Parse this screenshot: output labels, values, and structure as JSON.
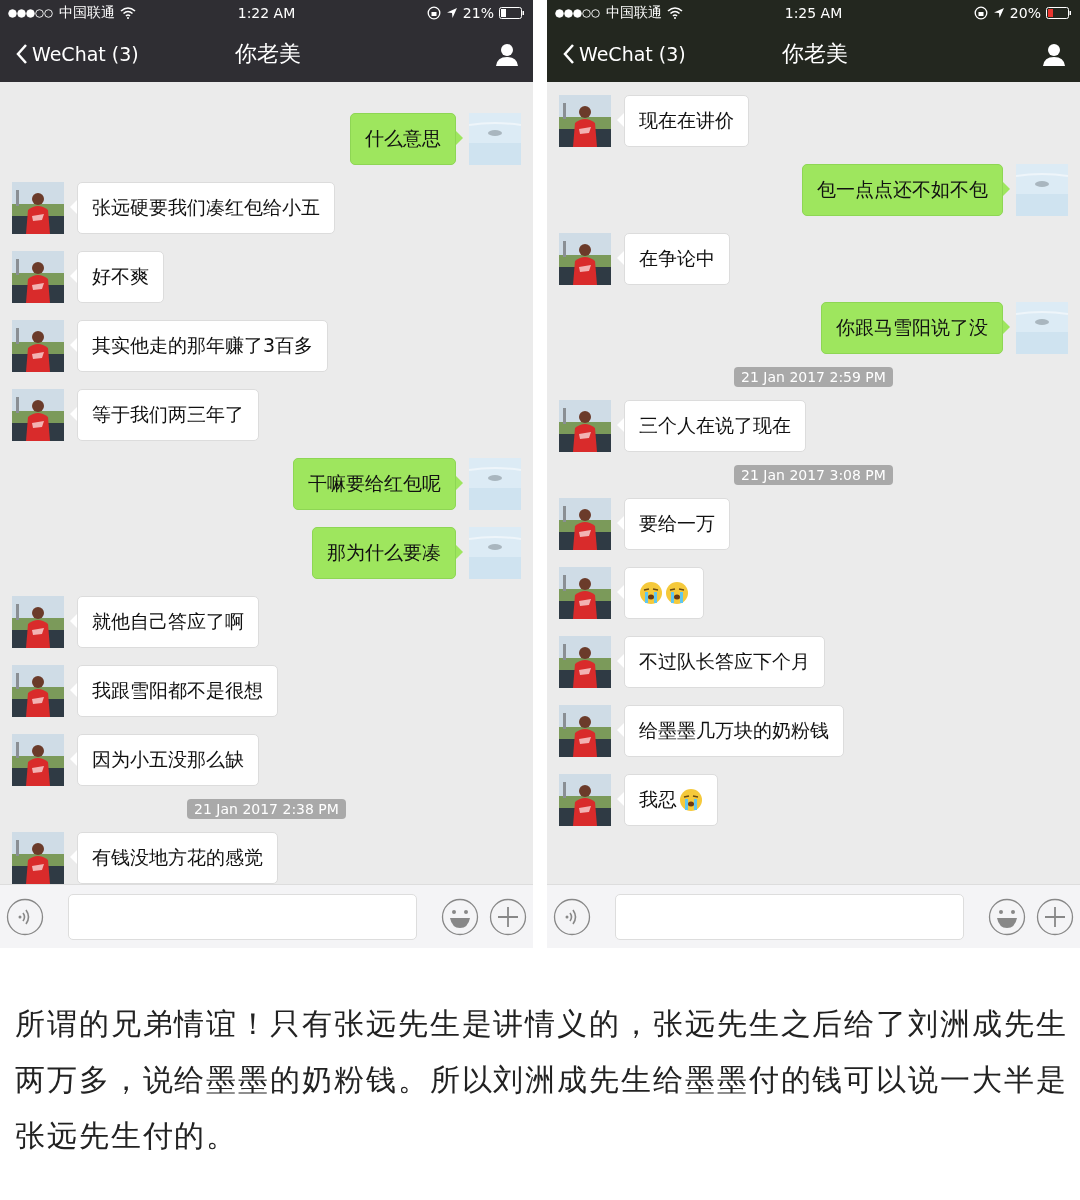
{
  "phones": [
    {
      "status_bar": {
        "carrier": "中国联通",
        "time": "1:22 AM",
        "battery": "21%",
        "low_battery": false
      },
      "nav": {
        "back": "WeChat (3)",
        "title": "你老美"
      },
      "messages": [
        {
          "kind": "message",
          "outgoing": true,
          "parts": [
            {
              "kind": "text",
              "text": "什么意思"
            }
          ]
        },
        {
          "kind": "message",
          "outgoing": false,
          "parts": [
            {
              "kind": "text",
              "text": "张远硬要我们凑红包给小五"
            }
          ]
        },
        {
          "kind": "message",
          "outgoing": false,
          "parts": [
            {
              "kind": "text",
              "text": "好不爽"
            }
          ]
        },
        {
          "kind": "message",
          "outgoing": false,
          "parts": [
            {
              "kind": "text",
              "text": "其实他走的那年赚了3百多"
            }
          ]
        },
        {
          "kind": "message",
          "outgoing": false,
          "parts": [
            {
              "kind": "text",
              "text": "等于我们两三年了"
            }
          ]
        },
        {
          "kind": "message",
          "outgoing": true,
          "parts": [
            {
              "kind": "text",
              "text": "干嘛要给红包呢"
            }
          ]
        },
        {
          "kind": "message",
          "outgoing": true,
          "parts": [
            {
              "kind": "text",
              "text": "那为什么要凑"
            }
          ]
        },
        {
          "kind": "message",
          "outgoing": false,
          "parts": [
            {
              "kind": "text",
              "text": "就他自己答应了啊"
            }
          ]
        },
        {
          "kind": "message",
          "outgoing": false,
          "parts": [
            {
              "kind": "text",
              "text": "我跟雪阳都不是很想"
            }
          ]
        },
        {
          "kind": "message",
          "outgoing": false,
          "parts": [
            {
              "kind": "text",
              "text": "因为小五没那么缺"
            }
          ]
        },
        {
          "kind": "time",
          "text": "21 Jan 2017 2:38 PM"
        },
        {
          "kind": "message",
          "outgoing": false,
          "parts": [
            {
              "kind": "text",
              "text": "有钱没地方花的感觉"
            }
          ]
        }
      ]
    },
    {
      "status_bar": {
        "carrier": "中国联通",
        "time": "1:25 AM",
        "battery": "20%",
        "low_battery": true
      },
      "nav": {
        "back": "WeChat (3)",
        "title": "你老美"
      },
      "messages": [
        {
          "kind": "message",
          "outgoing": false,
          "parts": [
            {
              "kind": "text",
              "text": "现在在讲价"
            }
          ]
        },
        {
          "kind": "message",
          "outgoing": true,
          "parts": [
            {
              "kind": "text",
              "text": "包一点点还不如不包"
            }
          ]
        },
        {
          "kind": "message",
          "outgoing": false,
          "parts": [
            {
              "kind": "text",
              "text": "在争论中"
            }
          ]
        },
        {
          "kind": "message",
          "outgoing": true,
          "parts": [
            {
              "kind": "text",
              "text": "你跟马雪阳说了没"
            }
          ]
        },
        {
          "kind": "time",
          "text": "21 Jan 2017 2:59 PM"
        },
        {
          "kind": "message",
          "outgoing": false,
          "parts": [
            {
              "kind": "text",
              "text": "三个人在说了现在"
            }
          ]
        },
        {
          "kind": "time",
          "text": "21 Jan 2017 3:08 PM"
        },
        {
          "kind": "message",
          "outgoing": false,
          "parts": [
            {
              "kind": "text",
              "text": "要给一万"
            }
          ]
        },
        {
          "kind": "message",
          "outgoing": false,
          "parts": [
            {
              "kind": "emoji"
            },
            {
              "kind": "emoji"
            }
          ]
        },
        {
          "kind": "message",
          "outgoing": false,
          "parts": [
            {
              "kind": "text",
              "text": "不过队长答应下个月"
            }
          ]
        },
        {
          "kind": "message",
          "outgoing": false,
          "parts": [
            {
              "kind": "text",
              "text": "给墨墨几万块的奶粉钱"
            }
          ]
        },
        {
          "kind": "message",
          "outgoing": false,
          "parts": [
            {
              "kind": "text",
              "text": "我忍"
            },
            {
              "kind": "emoji"
            }
          ]
        }
      ]
    }
  ],
  "caption": "所谓的兄弟情谊！只有张远先生是讲情义的，张远先生之后给了刘洲成先生两万多，说给墨墨的奶粉钱。所以刘洲成先生给墨墨付的钱可以说一大半是张远先生付的。"
}
